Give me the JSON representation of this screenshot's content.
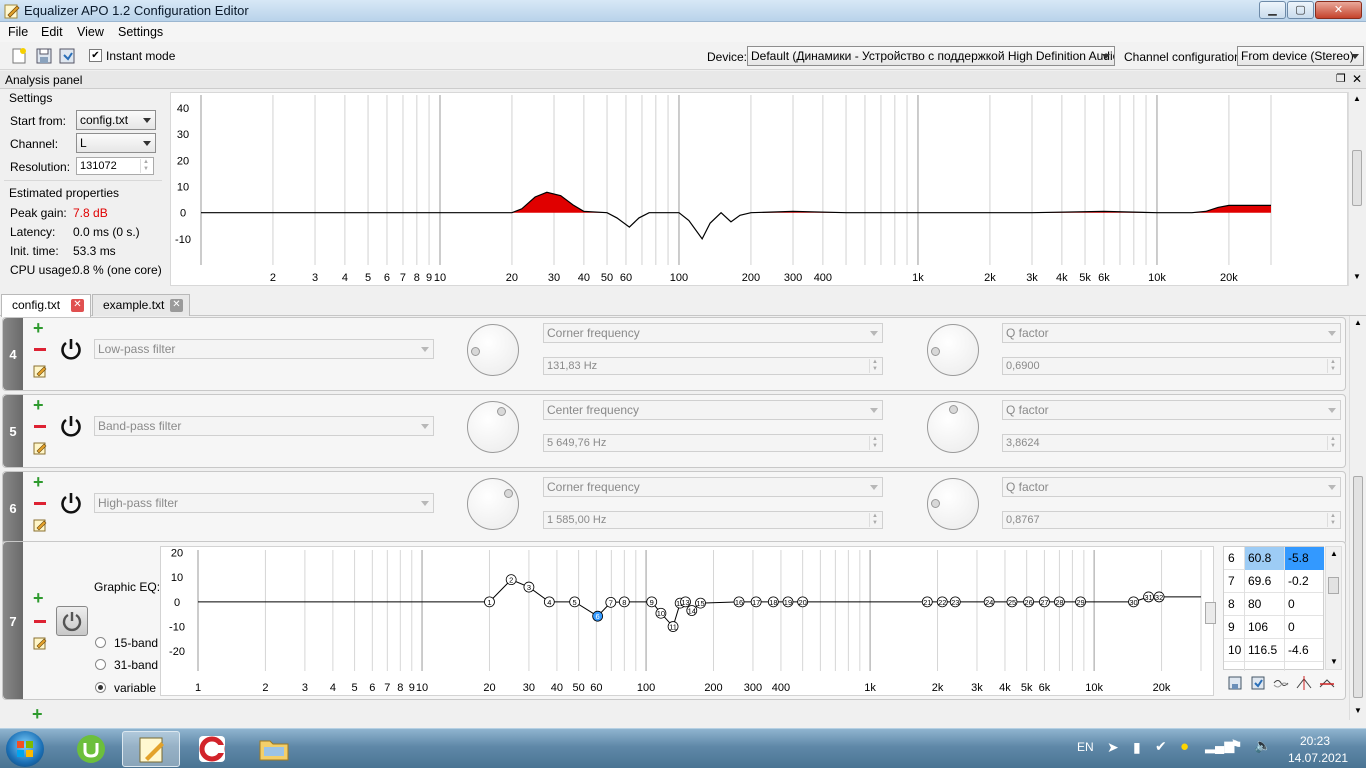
{
  "window": {
    "title": "Equalizer APO 1.2 Configuration Editor",
    "min": "▁",
    "max": "▢",
    "close": "✕"
  },
  "menu": [
    "File",
    "Edit",
    "View",
    "Settings"
  ],
  "toolbar": {
    "instant_mode": "Instant mode",
    "device_label": "Device:",
    "device_value": "Default (Динамики - Устройство с поддержкой High Definition Audio)",
    "channel_config_label": "Channel configuration:",
    "channel_config_value": "From device (Stereo)"
  },
  "analysis": {
    "header": "Analysis panel",
    "settings_title": "Settings",
    "start_from_label": "Start from:",
    "start_from_value": "config.txt",
    "channel_label": "Channel:",
    "channel_value": "L",
    "resolution_label": "Resolution:",
    "resolution_value": "131072",
    "estimated_title": "Estimated properties",
    "peak_gain_label": "Peak gain:",
    "peak_gain_value": "7.8 dB",
    "latency_label": "Latency:",
    "latency_value": "0.0 ms (0 s.)",
    "init_time_label": "Init. time:",
    "init_time_value": "53.3 ms",
    "cpu_label": "CPU usage:",
    "cpu_value": "0.8 % (one core)"
  },
  "chart_data": [
    {
      "type": "line",
      "y_ticks": [
        "40",
        "30",
        "20",
        "10",
        "0",
        "-10"
      ],
      "x_ticks": [
        "2",
        "3",
        "4",
        "5",
        "6",
        "7",
        "8",
        "9",
        "10",
        "20",
        "30",
        "40",
        "50",
        "60",
        "100",
        "200",
        "300",
        "400",
        "1k",
        "2k",
        "3k",
        "4k",
        "5k",
        "6k",
        "10k",
        "20k"
      ],
      "x_scale": "log",
      "ylim": [
        -20,
        45
      ],
      "x": [
        1,
        20,
        22,
        25,
        28,
        32,
        36,
        40,
        50,
        55,
        62,
        68,
        75,
        100,
        110,
        125,
        135,
        150,
        165,
        180,
        200,
        300,
        500,
        1000,
        3000,
        6000,
        10000,
        14000,
        16000,
        18000,
        20000,
        30000
      ],
      "y": [
        0,
        0,
        1.5,
        6,
        7.8,
        6.5,
        3,
        0.5,
        0,
        -2,
        -5.5,
        -2,
        0,
        0,
        -3,
        -10,
        -4,
        0,
        -3.5,
        -1,
        0,
        0.5,
        0,
        0,
        0,
        0.5,
        0,
        0,
        0.5,
        2,
        2.8,
        2.8
      ]
    },
    {
      "type": "line",
      "title": "Graphic EQ:",
      "y_ticks": [
        "20",
        "10",
        "0",
        "-10",
        "-20"
      ],
      "x_ticks": [
        "1",
        "2",
        "3",
        "4",
        "5",
        "6",
        "7",
        "8",
        "9",
        "10",
        "20",
        "30",
        "40",
        "50",
        "60",
        "100",
        "200",
        "300",
        "400",
        "1k",
        "2k",
        "3k",
        "4k",
        "5k",
        "6k",
        "10k",
        "20k"
      ],
      "x_scale": "log",
      "ylim": [
        -28,
        21
      ],
      "points": [
        {
          "n": "1",
          "x": 20,
          "y": 0
        },
        {
          "n": "2",
          "x": 25,
          "y": 9
        },
        {
          "n": "3",
          "x": 30,
          "y": 6
        },
        {
          "n": "4",
          "x": 37,
          "y": 0
        },
        {
          "n": "5",
          "x": 48,
          "y": 0
        },
        {
          "n": "6",
          "x": 60.8,
          "y": -5.8
        },
        {
          "n": "7",
          "x": 69.6,
          "y": -0.2
        },
        {
          "n": "8",
          "x": 80,
          "y": 0
        },
        {
          "n": "9",
          "x": 106,
          "y": 0
        },
        {
          "n": "10",
          "x": 116.5,
          "y": -4.6
        },
        {
          "n": "11",
          "x": 132,
          "y": -10
        },
        {
          "n": "12",
          "x": 142,
          "y": -0.5
        },
        {
          "n": "13",
          "x": 150,
          "y": 0
        },
        {
          "n": "14",
          "x": 160,
          "y": -3.5
        },
        {
          "n": "15",
          "x": 175,
          "y": -0.5
        },
        {
          "n": "16",
          "x": 260,
          "y": 0
        },
        {
          "n": "17",
          "x": 310,
          "y": 0
        },
        {
          "n": "18",
          "x": 370,
          "y": 0
        },
        {
          "n": "19",
          "x": 430,
          "y": 0
        },
        {
          "n": "20",
          "x": 500,
          "y": 0
        },
        {
          "n": "21",
          "x": 1800,
          "y": 0
        },
        {
          "n": "22",
          "x": 2100,
          "y": 0
        },
        {
          "n": "23",
          "x": 2400,
          "y": 0
        },
        {
          "n": "24",
          "x": 3400,
          "y": 0
        },
        {
          "n": "25",
          "x": 4300,
          "y": 0
        },
        {
          "n": "26",
          "x": 5100,
          "y": 0
        },
        {
          "n": "27",
          "x": 6000,
          "y": 0
        },
        {
          "n": "28",
          "x": 7000,
          "y": 0
        },
        {
          "n": "29",
          "x": 8700,
          "y": 0
        },
        {
          "n": "30",
          "x": 15000,
          "y": 0
        },
        {
          "n": "31",
          "x": 17500,
          "y": 2
        },
        {
          "n": "32",
          "x": 19500,
          "y": 2
        }
      ]
    }
  ],
  "tabs": [
    {
      "label": "config.txt"
    },
    {
      "label": "example.txt"
    }
  ],
  "filters": [
    {
      "num": "4",
      "type": "Low-pass filter",
      "p1_label": "Corner frequency",
      "p1_value": "131,83 Hz",
      "p2_label": "Q factor",
      "p2_value": "0,6900",
      "k1": 0.15,
      "k2": 0.15
    },
    {
      "num": "5",
      "type": "Band-pass filter",
      "p1_label": "Center frequency",
      "p1_value": "5 649,76 Hz",
      "p2_label": "Q factor",
      "p2_value": "3,8624",
      "k1": 0.6,
      "k2": 0.5
    },
    {
      "num": "6",
      "type": "High-pass filter",
      "p1_label": "Corner frequency",
      "p1_value": "1 585,00 Hz",
      "p2_label": "Q factor",
      "p2_value": "0,8767",
      "k1": 0.7,
      "k2": 0.18
    }
  ],
  "geq": {
    "num": "7",
    "label": "Graphic EQ:",
    "modes": [
      "15-band",
      "31-band",
      "variable"
    ],
    "selected_mode": "variable",
    "table": [
      {
        "i": "6",
        "f": "60.8",
        "g": "-5.8"
      },
      {
        "i": "7",
        "f": "69.6",
        "g": "-0.2"
      },
      {
        "i": "8",
        "f": "80",
        "g": "0"
      },
      {
        "i": "9",
        "f": "106",
        "g": "0"
      },
      {
        "i": "10",
        "f": "116.5",
        "g": "-4.6"
      }
    ]
  },
  "taskbar": {
    "lang": "EN",
    "time": "20:23",
    "date": "14.07.2021"
  },
  "colors": {
    "accent": "#e00000",
    "selection": "#3399ff",
    "plus": "#2e9a2e",
    "minus": "#d22233"
  }
}
